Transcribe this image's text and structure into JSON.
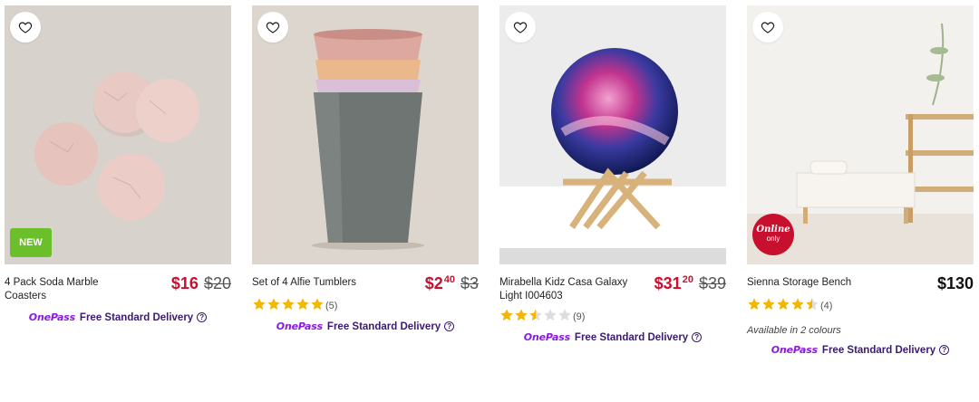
{
  "products": [
    {
      "title": "4 Pack Soda Marble Coasters",
      "price_now": "$16",
      "price_was": "$20",
      "badge": "NEW",
      "rating": null,
      "review_count": null,
      "colours_note": null,
      "delivery_brand": "OnePass",
      "delivery_label": "Free Standard Delivery",
      "help_icon": "?"
    },
    {
      "title": "Set of 4 Alfie Tumblers",
      "price_now_dollars": "$2",
      "price_now_cents": "40",
      "price_was": "$3",
      "rating": 5,
      "review_count": "(5)",
      "delivery_brand": "OnePass",
      "delivery_label": "Free Standard Delivery",
      "help_icon": "?"
    },
    {
      "title": "Mirabella Kidz Casa Galaxy Light I004603",
      "price_now_dollars": "$31",
      "price_now_cents": "20",
      "price_was": "$39",
      "rating": 2.5,
      "review_count": "(9)",
      "delivery_brand": "OnePass",
      "delivery_label": "Free Standard Delivery",
      "help_icon": "?"
    },
    {
      "title": "Sienna Storage Bench",
      "price": "$130",
      "badge_line1": "Online",
      "badge_line2": "only",
      "rating": 4.5,
      "review_count": "(4)",
      "colours_note": "Available in 2 colours",
      "delivery_brand": "OnePass",
      "delivery_label": "Free Standard Delivery",
      "help_icon": "?"
    }
  ],
  "icons": {
    "wishlist": "heart-outline-icon",
    "star_color": "#f2b705",
    "star_empty_color": "#dddddd"
  },
  "colors": {
    "sale_price": "#c8102e",
    "onepass": "#8a1bdc",
    "new_badge": "#6abf2a",
    "online_badge": "#c8102e"
  }
}
